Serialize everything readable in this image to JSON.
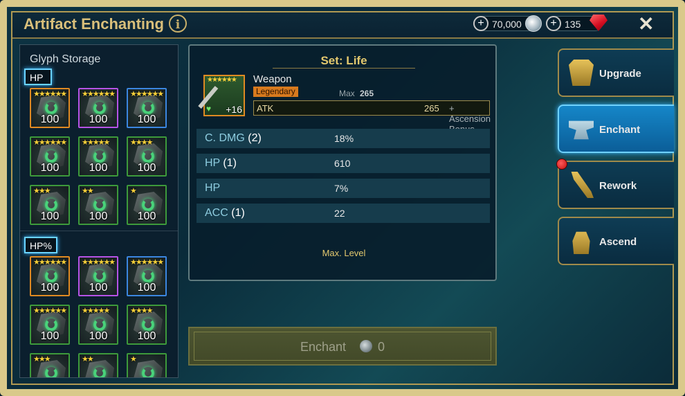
{
  "header": {
    "title": "Artifact Enchanting",
    "info_label": "i",
    "currency_silver": "70,000",
    "currency_rubies": "135",
    "close_label": "✕"
  },
  "glyph_storage": {
    "title": "Glyph Storage",
    "sections": [
      {
        "label": "HP",
        "glyphs": [
          {
            "stars": "★★★★★★",
            "value": "100",
            "frame": "orange"
          },
          {
            "stars": "★★★★★★",
            "value": "100",
            "frame": "purple"
          },
          {
            "stars": "★★★★★★",
            "value": "100",
            "frame": "blue"
          },
          {
            "stars": "★★★★★★",
            "value": "100",
            "frame": "green"
          },
          {
            "stars": "★★★★★",
            "value": "100",
            "frame": "green"
          },
          {
            "stars": "★★★★",
            "value": "100",
            "frame": "green"
          },
          {
            "stars": "★★★",
            "value": "100",
            "frame": "green"
          },
          {
            "stars": "★★",
            "value": "100",
            "frame": "green"
          },
          {
            "stars": "★",
            "value": "100",
            "frame": "green"
          }
        ]
      },
      {
        "label": "HP%",
        "glyphs": [
          {
            "stars": "★★★★★★",
            "value": "100",
            "frame": "orange"
          },
          {
            "stars": "★★★★★★",
            "value": "100",
            "frame": "purple"
          },
          {
            "stars": "★★★★★★",
            "value": "100",
            "frame": "blue"
          },
          {
            "stars": "★★★★★★",
            "value": "100",
            "frame": "green"
          },
          {
            "stars": "★★★★★",
            "value": "100",
            "frame": "green"
          },
          {
            "stars": "★★★★",
            "value": "100",
            "frame": "green"
          },
          {
            "stars": "★★★",
            "value": "",
            "frame": "green"
          },
          {
            "stars": "★★",
            "value": "",
            "frame": "green"
          },
          {
            "stars": "★",
            "value": "",
            "frame": "green"
          }
        ]
      }
    ]
  },
  "artifact": {
    "set_title": "Set: Life",
    "stars": "★★★★★★",
    "level": "+16",
    "name": "Weapon",
    "rarity": "Legendary",
    "max_label": "Max",
    "max_value": "265",
    "main_stat": {
      "name": "ATK",
      "value": "265",
      "bonus": "+ Ascension Bonus"
    },
    "substats": [
      {
        "name": "C. DMG",
        "rolls": "(2)",
        "value": "18%"
      },
      {
        "name": "HP",
        "rolls": "(1)",
        "value": "610"
      },
      {
        "name": "HP",
        "rolls": "",
        "value": "7%"
      },
      {
        "name": "ACC",
        "rolls": "(1)",
        "value": "22"
      }
    ],
    "max_level_text": "Max. Level"
  },
  "enchant_button": {
    "label": "Enchant",
    "cost": "0"
  },
  "side_menu": [
    {
      "label": "Upgrade",
      "icon": "armor-icon",
      "active": false
    },
    {
      "label": "Enchant",
      "icon": "anvil-icon",
      "active": true
    },
    {
      "label": "Rework",
      "icon": "tools-icon",
      "active": false
    },
    {
      "label": "Ascend",
      "icon": "helmet-icon",
      "active": false
    }
  ],
  "colors": {
    "gold": "#d9bf7a",
    "active_tab": "#1586c8",
    "legendary": "#d87a1e"
  }
}
